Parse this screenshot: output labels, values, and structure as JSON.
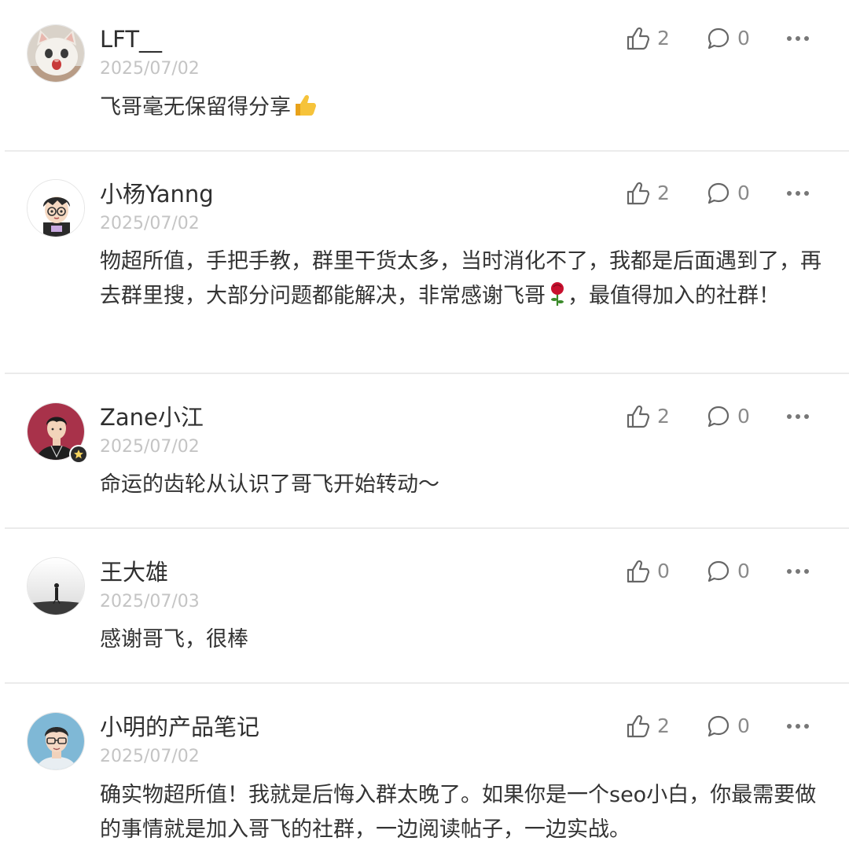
{
  "comments": [
    {
      "author": "LFT__",
      "date": "2025/07/02",
      "text": "飞哥毫无保留得分享",
      "text_suffix_emoji": "thumbs-up",
      "likes": "2",
      "replies": "0",
      "avatar": "white-kitten-avatar"
    },
    {
      "author": "小杨Yanng",
      "date": "2025/07/02",
      "text_before_emoji": "物超所值，手把手教，群里干货太多，当时消化不了，我都是后面遇到了，再去群里搜，大部分问题都能解决，非常感谢飞哥",
      "text_emoji": "rose",
      "text_after_emoji": "，最值得加入的社群！",
      "likes": "2",
      "replies": "0",
      "avatar": "cartoon-boy-glasses-avatar"
    },
    {
      "author": "Zane小江",
      "date": "2025/07/02",
      "text": "命运的齿轮从认识了哥飞开始转动～",
      "likes": "2",
      "replies": "0",
      "avatar": "young-man-red-background-avatar",
      "badge": "star-badge"
    },
    {
      "author": "王大雄",
      "date": "2025/07/03",
      "text": "感谢哥飞，很棒",
      "likes": "0",
      "replies": "0",
      "avatar": "lone-figure-silhouette-avatar"
    },
    {
      "author": "小明的产品笔记",
      "date": "2025/07/02",
      "text": "确实物超所值！我就是后悔入群太晚了。如果你是一个seo小白，你最需要做的事情就是加入哥飞的社群，一边阅读帖子，一边实战。",
      "likes": "2",
      "replies": "0",
      "avatar": "man-glasses-blue-background-avatar"
    }
  ],
  "icons": {
    "like": "thumbs-up-outline-icon",
    "comment": "speech-bubble-outline-icon",
    "more": "more-dots-icon"
  },
  "colors": {
    "text": "#333333",
    "meta": "#c4c4c4",
    "count": "#8a8a8a",
    "divider": "#ebebeb"
  }
}
